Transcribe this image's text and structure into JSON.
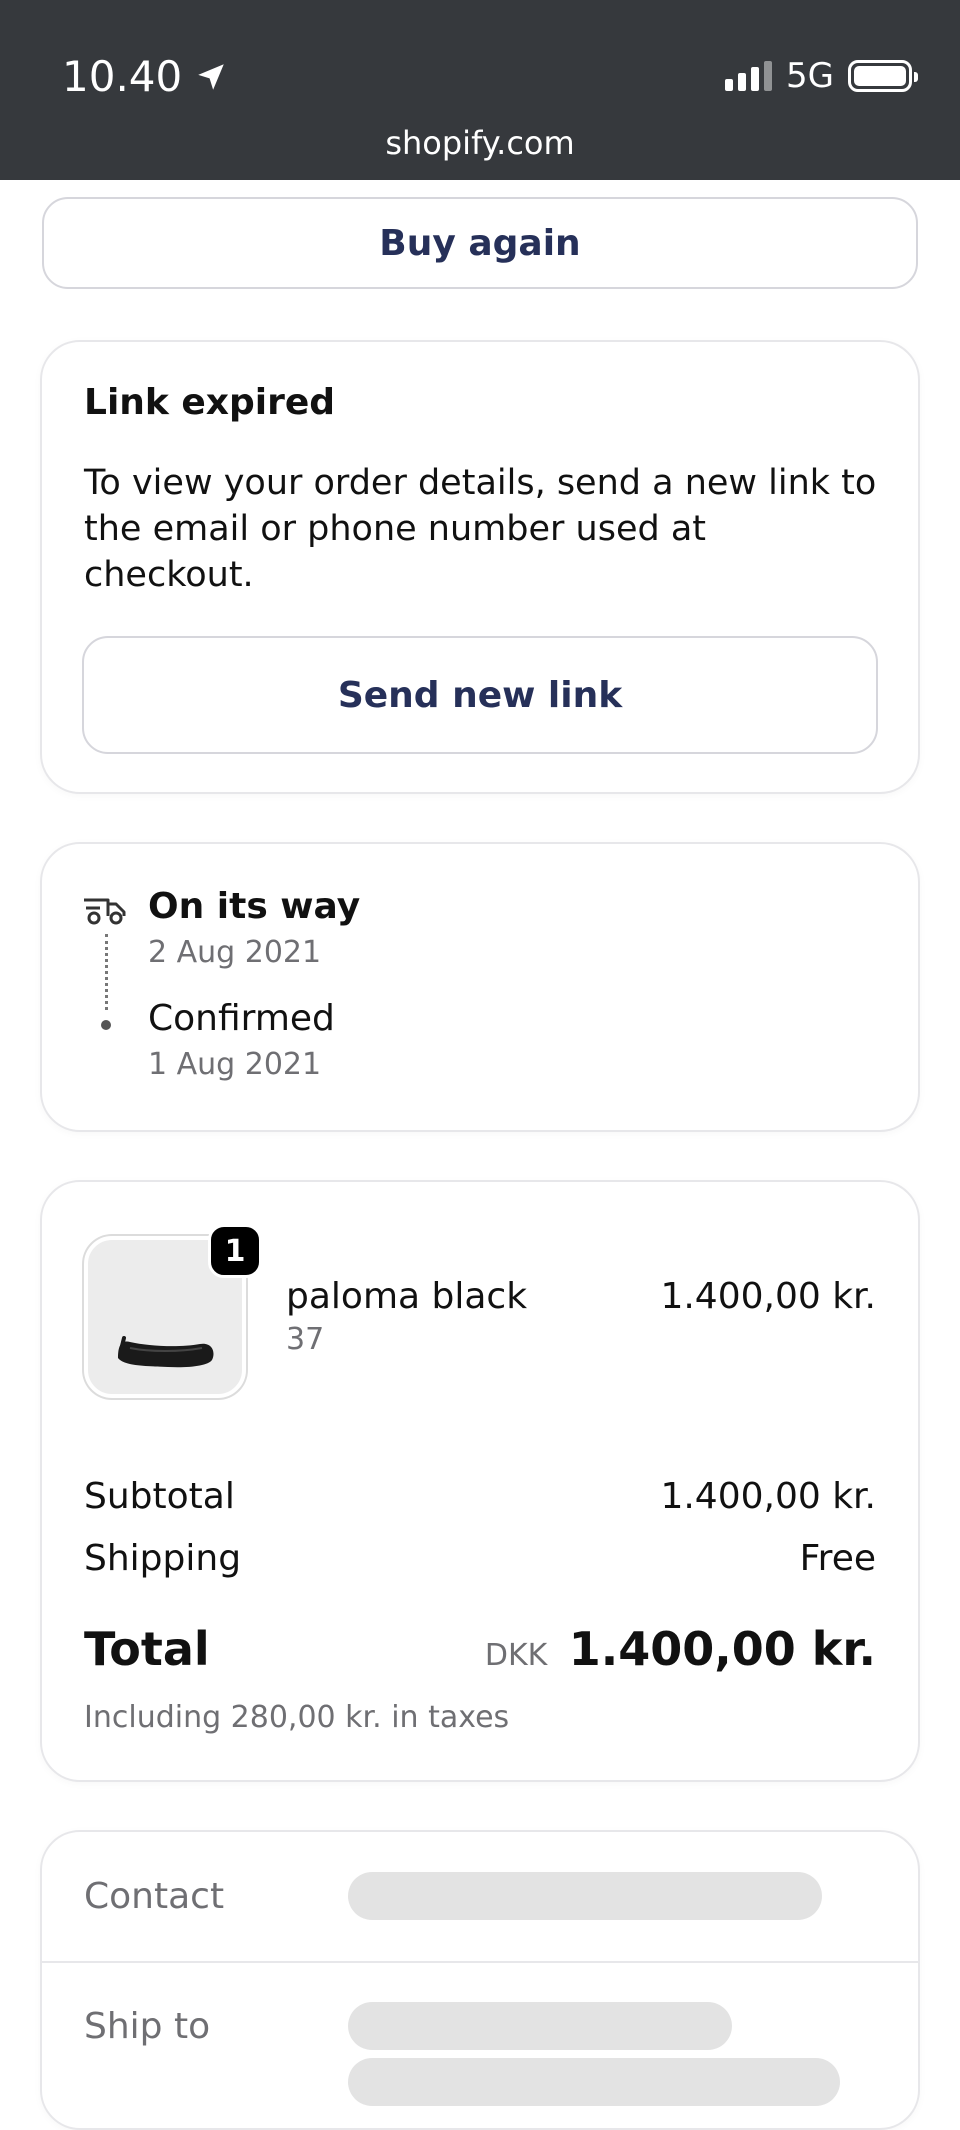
{
  "status_bar": {
    "time": "10.40",
    "network": "5G",
    "url": "shopify.com"
  },
  "buy_again": {
    "label": "Buy again"
  },
  "link_card": {
    "title": "Link expired",
    "body": "To view your order details, send a new link to the email or phone number used at checkout.",
    "button": "Send new link"
  },
  "tracking": [
    {
      "status": "On its way",
      "date": "2 Aug 2021"
    },
    {
      "status": "Confirmed",
      "date": "1 Aug 2021"
    }
  ],
  "order": {
    "item": {
      "name": "paloma black",
      "variant": "37",
      "price": "1.400,00 kr.",
      "quantity": "1"
    },
    "subtotal_label": "Subtotal",
    "subtotal": "1.400,00 kr.",
    "shipping_label": "Shipping",
    "shipping": "Free",
    "total_label": "Total",
    "currency": "DKK",
    "total": "1.400,00 kr.",
    "tax_note": "Including 280,00 kr. in taxes"
  },
  "details": {
    "contact_label": "Contact",
    "ship_to_label": "Ship to"
  },
  "colors": {
    "accent": "#263059",
    "status_bar": "#36393d",
    "skeleton": "#e3e3e3"
  }
}
